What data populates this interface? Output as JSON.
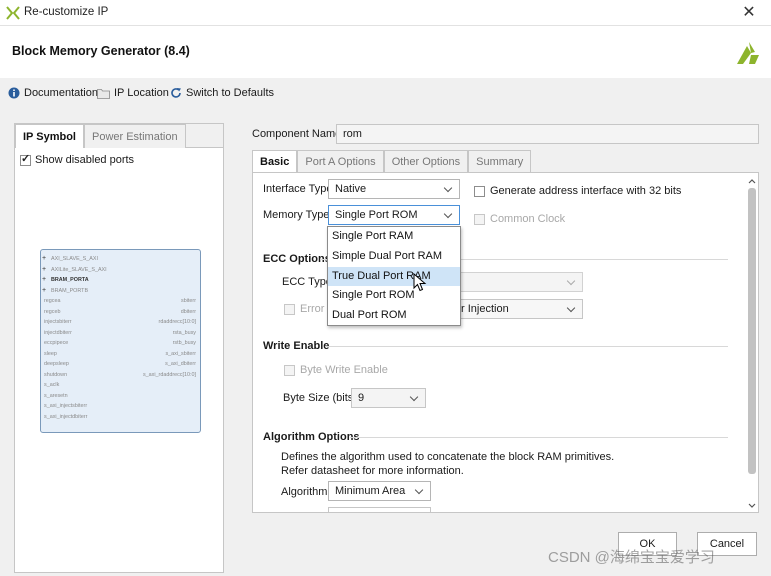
{
  "window": {
    "title": "Re-customize IP",
    "close_glyph": "✕"
  },
  "header": {
    "title": "Block Memory Generator (8.4)",
    "logo_icon": "xilinx-logo"
  },
  "toolbar": {
    "documentation": "Documentation",
    "ip_location": "IP Location",
    "switch_defaults": "Switch to Defaults"
  },
  "left_panel": {
    "tabs": [
      "IP Symbol",
      "Power Estimation"
    ],
    "show_disabled_ports": "Show disabled ports",
    "symbol": {
      "left_ports": [
        "AXI_SLAVE_S_AXI",
        "AXILite_SLAVE_S_AXI",
        "BRAM_PORTA",
        "BRAM_PORTB",
        "regcea",
        "regceb",
        "injectsbiterr",
        "injectdbiterr",
        "eccpipece",
        "sleep",
        "deepsleep",
        "shutdown",
        "s_aclk",
        "s_aresetn",
        "s_axi_injectsbiterr",
        "s_axi_injectdbiterr"
      ],
      "right_ports": [
        "sbiterr",
        "dbiterr",
        "rdaddrecc[10:0]",
        "rsta_busy",
        "rstb_busy",
        "s_axi_sbiterr",
        "s_axi_dbiterr",
        "s_axi_rdaddrecc[10:0]"
      ]
    }
  },
  "component": {
    "label": "Component Name",
    "value": "rom"
  },
  "tabs": [
    "Basic",
    "Port A Options",
    "Other Options",
    "Summary"
  ],
  "basic": {
    "interface_type_label": "Interface Type",
    "interface_type_value": "Native",
    "memory_type_label": "Memory Type",
    "memory_type_value": "Single Port ROM",
    "gen_addr_label": "Generate address interface with 32 bits",
    "common_clock_label": "Common Clock",
    "memory_type_options": [
      "Single Port RAM",
      "Simple Dual Port RAM",
      "True Dual Port RAM",
      "Single Port ROM",
      "Dual Port ROM"
    ],
    "hovered_option": "True Dual Port RAM"
  },
  "ecc": {
    "section": "ECC Options",
    "ecc_type_label": "ECC Type",
    "error_label": "Error I",
    "injection_value": "r Injection"
  },
  "write_enable": {
    "section": "Write Enable",
    "byte_write_label": "Byte Write Enable",
    "byte_size_label": "Byte Size (bits)",
    "byte_size_value": "9"
  },
  "algorithm": {
    "section": "Algorithm Options",
    "desc1": "Defines the algorithm used to concatenate the block RAM primitives.",
    "desc2": "Refer datasheet for more information.",
    "label": "Algorithm",
    "value": "Minimum Area"
  },
  "buttons": {
    "ok": "OK",
    "cancel": "Cancel"
  },
  "watermark": "CSDN @海绵宝宝爱学习",
  "colors": {
    "accent": "#4a90d9",
    "hover": "#cfe4f7",
    "symbol_fill": "#e5eef8",
    "logo": "#8db42d"
  }
}
